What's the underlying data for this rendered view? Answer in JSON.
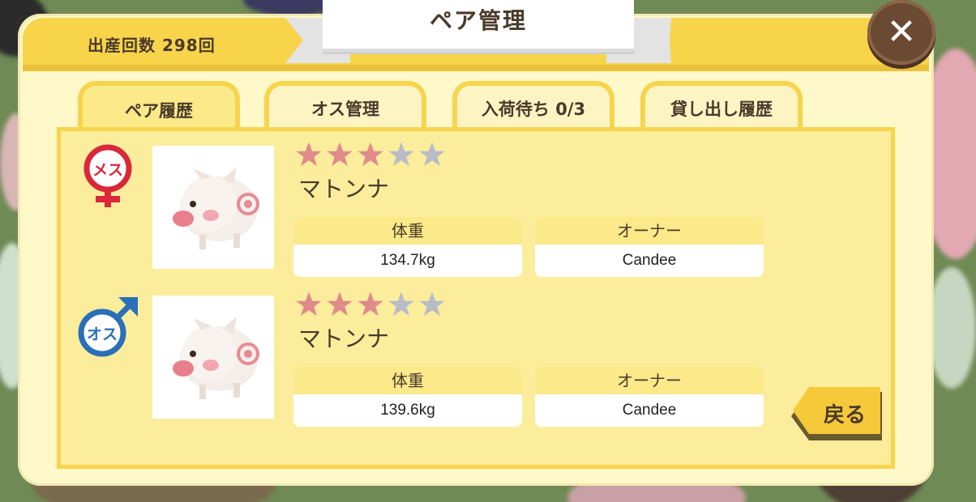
{
  "header": {
    "title": "ペア管理",
    "birth_count_label": "出産回数 298回"
  },
  "tabs": [
    {
      "label": "ペア履歴",
      "active": true
    },
    {
      "label": "オス管理",
      "active": false
    },
    {
      "label": "入荷待ち 0/3",
      "active": false
    },
    {
      "label": "貸し出し履歴",
      "active": false
    }
  ],
  "pairs": [
    {
      "sex_label": "メス",
      "sex_color": "#d8283a",
      "rating": 3,
      "rating_max": 5,
      "name": "マトンナ",
      "weight_header": "体重",
      "weight": "134.7kg",
      "owner_header": "オーナー",
      "owner": "Candee"
    },
    {
      "sex_label": "オス",
      "sex_color": "#2a6fb8",
      "rating": 3,
      "rating_max": 5,
      "name": "マトンナ",
      "weight_header": "体重",
      "weight": "139.6kg",
      "owner_header": "オーナー",
      "owner": "Candee"
    }
  ],
  "buttons": {
    "close_icon": "close-x-icon",
    "back_label": "戻る"
  },
  "colors": {
    "star_on": "#e08a8a",
    "star_off": "#b8bcc6",
    "accent_yellow": "#f7d44a"
  }
}
